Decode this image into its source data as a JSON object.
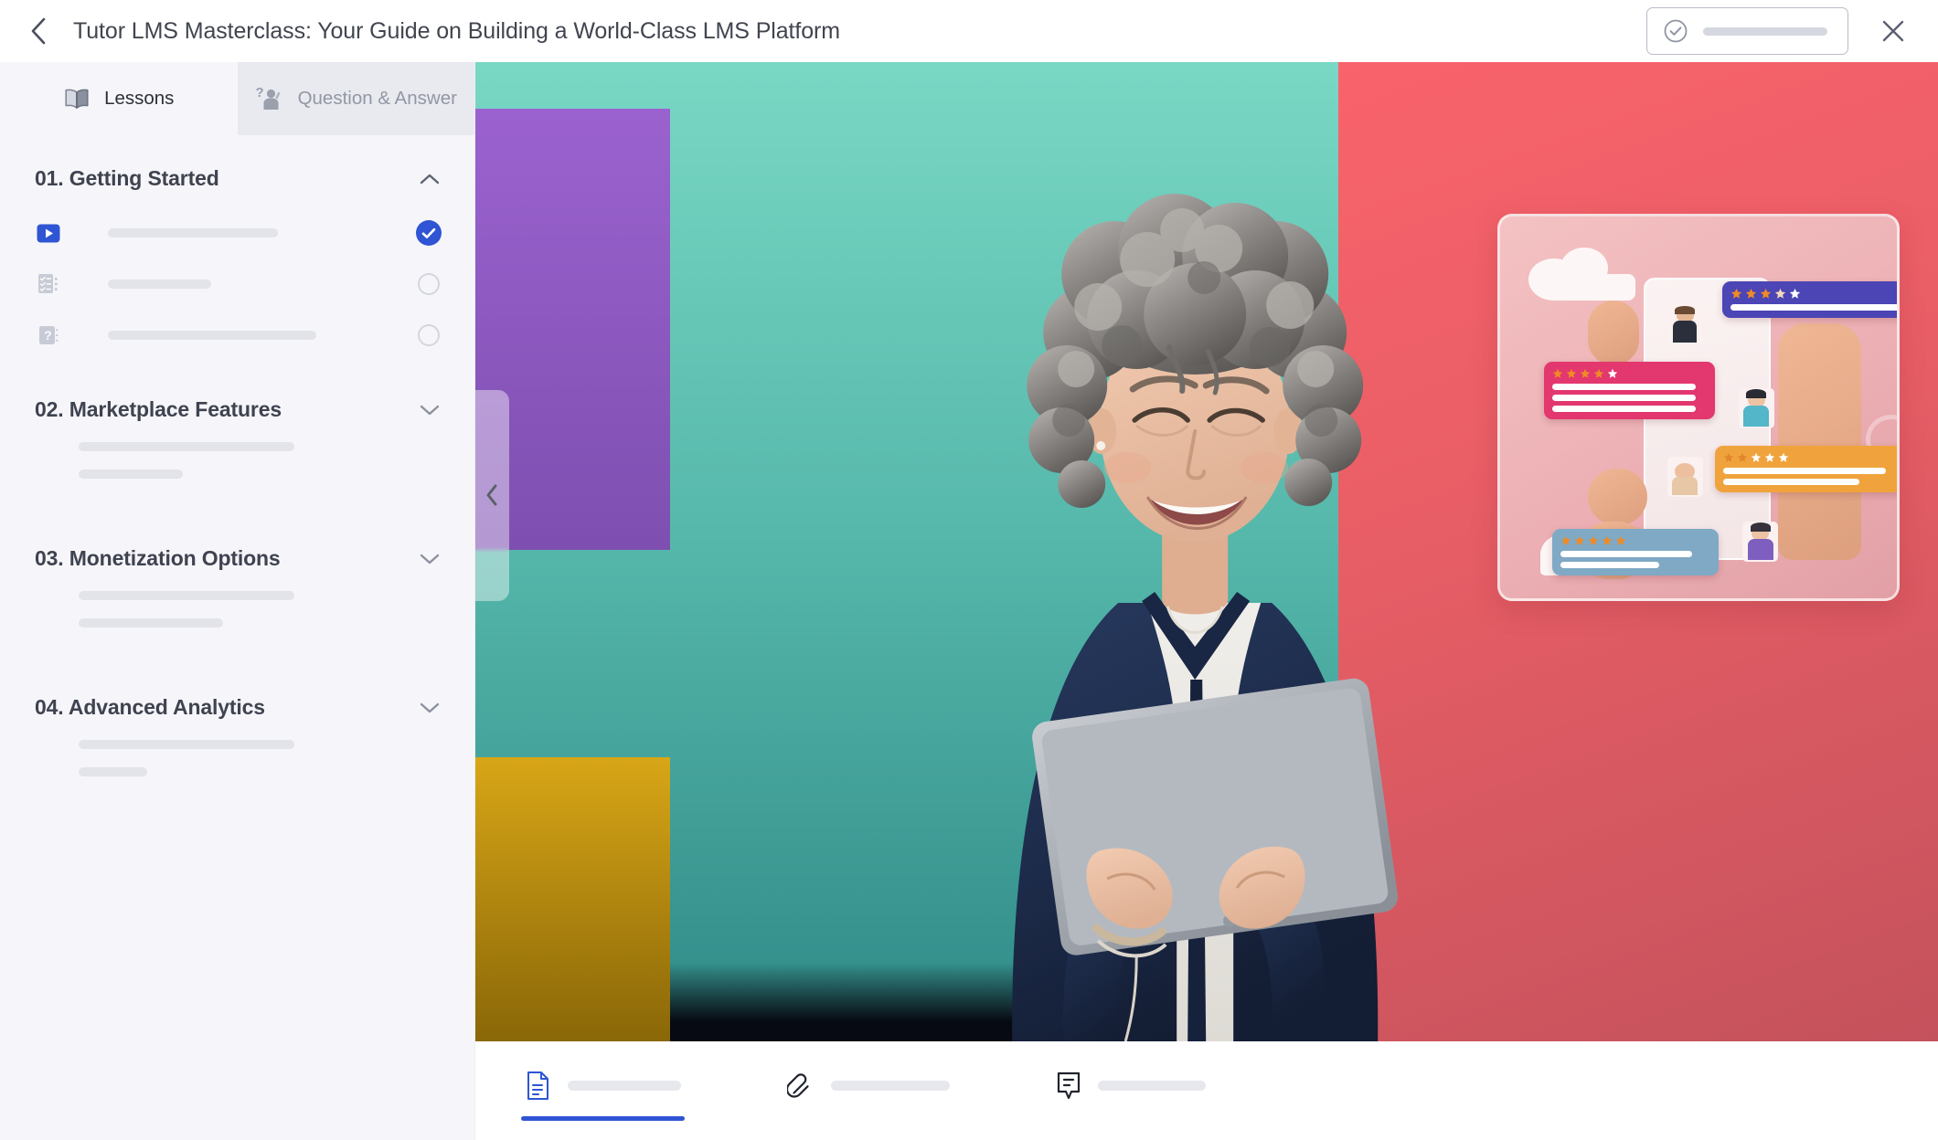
{
  "header": {
    "back_icon": "chevron-left-icon",
    "title": "Tutor LMS Masterclass: Your Guide on Building a World-Class LMS Platform",
    "complete_button": {
      "icon": "check-circle-icon",
      "label_skeleton": true
    },
    "close_icon": "close-icon"
  },
  "sidebar": {
    "tabs": [
      {
        "id": "lessons",
        "label": "Lessons",
        "icon": "book-icon",
        "active": true
      },
      {
        "id": "qna",
        "label": "Question & Answer",
        "icon": "question-person-icon",
        "active": false
      }
    ],
    "collapse_handle_icon": "chevron-left-icon",
    "sections": [
      {
        "id": "section-01",
        "title": "01. Getting Started",
        "expanded": true,
        "chevron": "chevron-up-icon",
        "lessons": [
          {
            "icon": "video-play-icon",
            "status": "completed",
            "skeleton_width": 186
          },
          {
            "icon": "quiz-checklist-icon",
            "status": "not-started",
            "skeleton_width": 113
          },
          {
            "icon": "assignment-question-icon",
            "status": "not-started",
            "skeleton_width": 228
          }
        ]
      },
      {
        "id": "section-02",
        "title": "02. Marketplace Features",
        "expanded": false,
        "chevron": "chevron-down-icon",
        "skeleton_widths": [
          236,
          114
        ]
      },
      {
        "id": "section-03",
        "title": "03. Monetization Options",
        "expanded": false,
        "chevron": "chevron-down-icon",
        "skeleton_widths": [
          236,
          158
        ]
      },
      {
        "id": "section-04",
        "title": "04. Advanced Analytics",
        "expanded": false,
        "chevron": "chevron-down-icon",
        "skeleton_widths": [
          236,
          75
        ]
      }
    ]
  },
  "player": {
    "media_type": "video",
    "scene_description": "Smiling woman with curly grey hair holding a tablet, colour-blocked teal, red, purple and gold background, with a 3D review-bubbles illustration card",
    "colors": {
      "teal": "#56b8ab",
      "red": "#e95e66",
      "purple": "#7e4fb0",
      "gold": "#b8880f",
      "card_pink": "#ecb0b4",
      "bubble_indigo": "#4b45b5",
      "bubble_pink": "#e3376f",
      "bubble_orange": "#f0a33c",
      "bubble_blue": "#7fa9c5",
      "star_orange": "#f08a24",
      "star_white": "#ffffff"
    },
    "illustration": {
      "bubbles": [
        {
          "color": "#4b45b5",
          "stars_filled": 4,
          "stars_total": 5,
          "lines": 1
        },
        {
          "color": "#e3376f",
          "stars_filled": 4,
          "stars_total": 5,
          "lines": 3
        },
        {
          "color": "#f0a33c",
          "stars_filled": 2,
          "stars_total": 5,
          "lines": 2
        },
        {
          "color": "#7fa9c5",
          "stars_filled": 5,
          "stars_total": 5,
          "lines": 2
        }
      ]
    }
  },
  "bottom_tabs": [
    {
      "id": "overview",
      "icon": "document-icon",
      "active": true,
      "skeleton_width": 124
    },
    {
      "id": "attachments",
      "icon": "paperclip-icon",
      "active": false,
      "skeleton_width": 130
    },
    {
      "id": "comments",
      "icon": "comment-icon",
      "active": false,
      "skeleton_width": 118
    }
  ],
  "accent_color": "#2f55d4"
}
